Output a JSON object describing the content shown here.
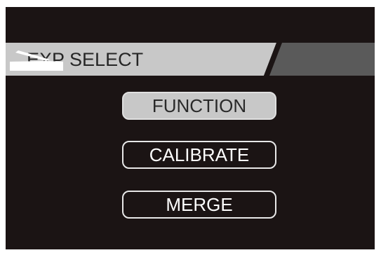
{
  "header": {
    "title": "EXP SELECT",
    "icon": "expression-pedal-icon"
  },
  "menu": {
    "items": [
      {
        "label": "FUNCTION",
        "selected": true
      },
      {
        "label": "CALIBRATE",
        "selected": false
      },
      {
        "label": "MERGE",
        "selected": false
      }
    ]
  },
  "colors": {
    "screen_background": "#1b1414",
    "title_bar": "#c8c8c8",
    "title_bar_dark": "#595959",
    "selected_button": "#c8c8c8",
    "button_border": "#e8e8e8",
    "text_light": "#ffffff",
    "text_dark": "#262626"
  }
}
